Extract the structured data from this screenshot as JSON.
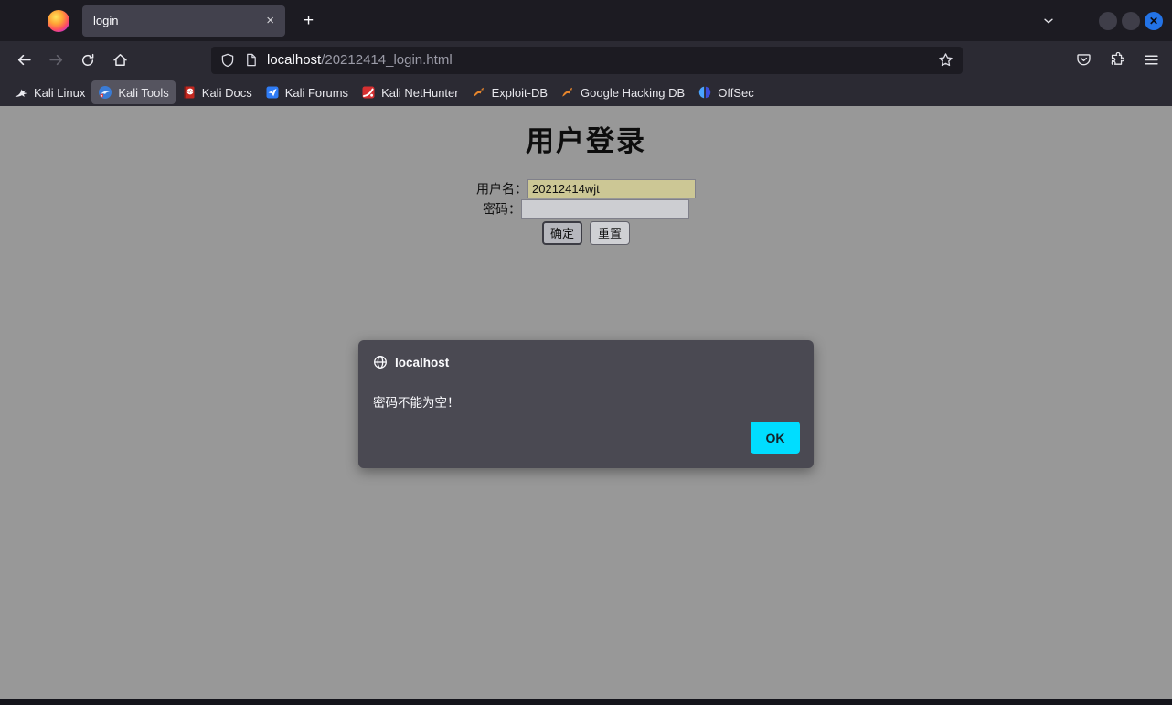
{
  "tabbar": {
    "tab_title": "login",
    "close_glyph": "×",
    "new_tab_glyph": "+"
  },
  "toolbar": {
    "url_host": "localhost",
    "url_path": "/20212414_login.html"
  },
  "bookmarks": {
    "items": [
      {
        "label": "Kali Linux",
        "icon": "kali-dragon-icon"
      },
      {
        "label": "Kali Tools",
        "icon": "kali-tools-icon",
        "active": true
      },
      {
        "label": "Kali Docs",
        "icon": "kali-docs-icon"
      },
      {
        "label": "Kali Forums",
        "icon": "kali-forums-icon"
      },
      {
        "label": "Kali NetHunter",
        "icon": "kali-nethunter-icon"
      },
      {
        "label": "Exploit-DB",
        "icon": "exploit-db-icon"
      },
      {
        "label": "Google Hacking DB",
        "icon": "google-hacking-db-icon"
      },
      {
        "label": "OffSec",
        "icon": "offsec-icon"
      }
    ]
  },
  "page": {
    "title": "用户登录",
    "username_label": "用户名：",
    "username_value": "20212414wjt",
    "password_label": "密码：",
    "password_value": "",
    "submit_label": "确定",
    "reset_label": "重置",
    "background_color": "#989898",
    "autofill_color": "#ccc795"
  },
  "dialog": {
    "source": "localhost",
    "message": "密码不能为空！",
    "ok_label": "OK",
    "accent_color": "#00ddff",
    "background_color": "#4a4952"
  }
}
